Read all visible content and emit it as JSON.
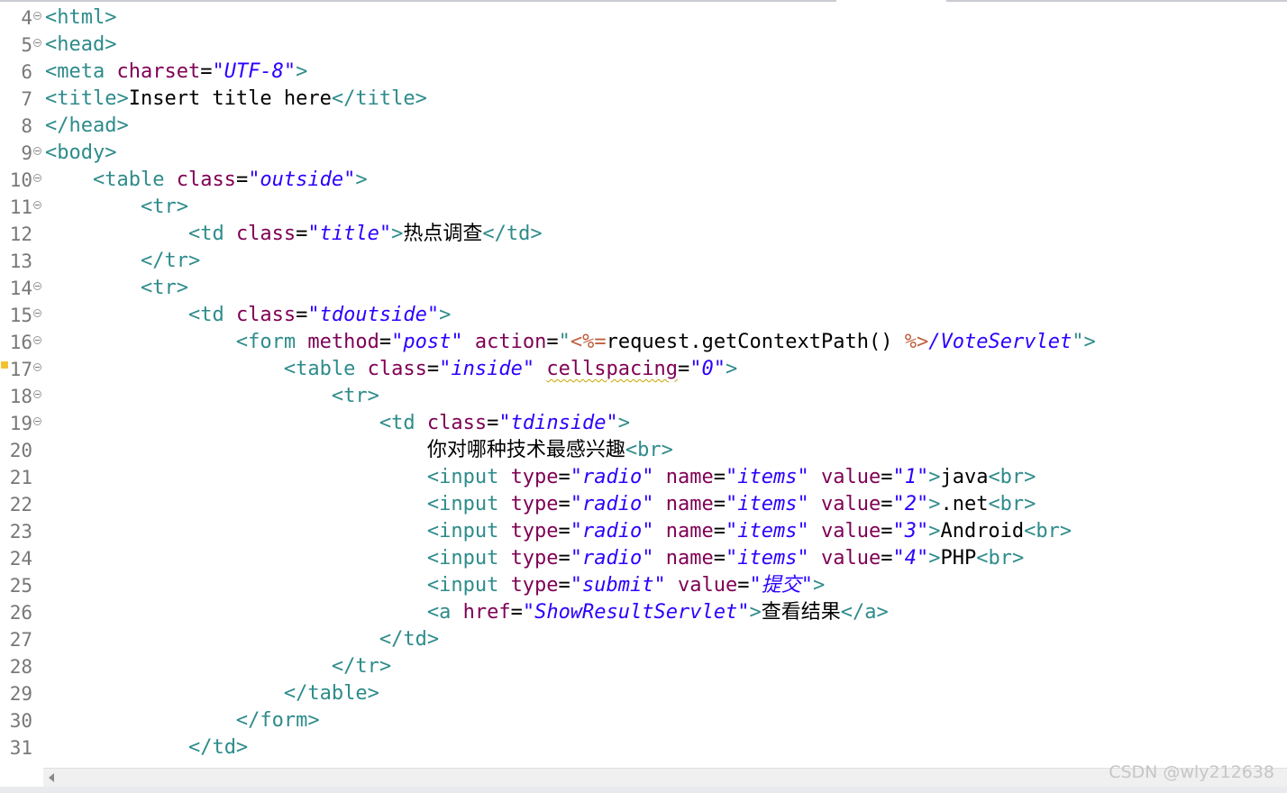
{
  "editor": {
    "lines": [
      {
        "num": "4",
        "fold": true,
        "warning": false,
        "indent": "",
        "segs": [
          [
            "t",
            "<html>"
          ]
        ]
      },
      {
        "num": "5",
        "fold": true,
        "warning": false,
        "indent": "",
        "segs": [
          [
            "t",
            "<head>"
          ]
        ]
      },
      {
        "num": "6",
        "fold": false,
        "warning": false,
        "indent": "",
        "segs": [
          [
            "t",
            "<meta "
          ],
          [
            "a",
            "charset"
          ],
          [
            "x",
            "="
          ],
          [
            "v",
            "\"UTF-8\""
          ],
          [
            "t",
            ">"
          ]
        ]
      },
      {
        "num": "7",
        "fold": false,
        "warning": false,
        "indent": "",
        "segs": [
          [
            "t",
            "<title>"
          ],
          [
            "x",
            "Insert title here"
          ],
          [
            "t",
            "</title>"
          ]
        ]
      },
      {
        "num": "8",
        "fold": false,
        "warning": false,
        "indent": "",
        "segs": [
          [
            "t",
            "</head>"
          ]
        ]
      },
      {
        "num": "9",
        "fold": true,
        "warning": false,
        "indent": "",
        "segs": [
          [
            "t",
            "<body>"
          ]
        ]
      },
      {
        "num": "10",
        "fold": true,
        "warning": false,
        "indent": "    ",
        "segs": [
          [
            "t",
            "<table "
          ],
          [
            "a",
            "class"
          ],
          [
            "x",
            "="
          ],
          [
            "v",
            "\"outside\""
          ],
          [
            "t",
            ">"
          ]
        ]
      },
      {
        "num": "11",
        "fold": true,
        "warning": false,
        "indent": "        ",
        "segs": [
          [
            "t",
            "<tr>"
          ]
        ]
      },
      {
        "num": "12",
        "fold": false,
        "warning": false,
        "indent": "            ",
        "segs": [
          [
            "t",
            "<td "
          ],
          [
            "a",
            "class"
          ],
          [
            "x",
            "="
          ],
          [
            "v",
            "\"title\""
          ],
          [
            "t",
            ">"
          ],
          [
            "xc",
            "热点调查"
          ],
          [
            "t",
            "</td>"
          ]
        ]
      },
      {
        "num": "13",
        "fold": false,
        "warning": false,
        "indent": "        ",
        "segs": [
          [
            "t",
            "</tr>"
          ]
        ]
      },
      {
        "num": "14",
        "fold": true,
        "warning": false,
        "indent": "        ",
        "segs": [
          [
            "t",
            "<tr>"
          ]
        ]
      },
      {
        "num": "15",
        "fold": true,
        "warning": false,
        "indent": "            ",
        "segs": [
          [
            "t",
            "<td "
          ],
          [
            "a",
            "class"
          ],
          [
            "x",
            "="
          ],
          [
            "v",
            "\"tdoutside\""
          ],
          [
            "t",
            ">"
          ]
        ]
      },
      {
        "num": "16",
        "fold": true,
        "warning": false,
        "indent": "                ",
        "segs": [
          [
            "t",
            "<form "
          ],
          [
            "a",
            "method"
          ],
          [
            "x",
            "="
          ],
          [
            "v",
            "\"post\""
          ],
          [
            "x",
            " "
          ],
          [
            "a",
            "action"
          ],
          [
            "x",
            "="
          ],
          [
            "t",
            "\""
          ],
          [
            "j",
            "<%="
          ],
          [
            "x",
            "request.getContextPath() "
          ],
          [
            "j",
            "%>"
          ],
          [
            "v",
            "/VoteServlet"
          ],
          [
            "t",
            "\">"
          ]
        ]
      },
      {
        "num": "17",
        "fold": true,
        "warning": true,
        "indent": "                    ",
        "segs": [
          [
            "t",
            "<table "
          ],
          [
            "a",
            "class"
          ],
          [
            "x",
            "="
          ],
          [
            "v",
            "\"inside\""
          ],
          [
            "x",
            " "
          ],
          [
            "aw",
            "cellspacing"
          ],
          [
            "x",
            "="
          ],
          [
            "v",
            "\"0\""
          ],
          [
            "t",
            ">"
          ]
        ]
      },
      {
        "num": "18",
        "fold": true,
        "warning": false,
        "indent": "                        ",
        "segs": [
          [
            "t",
            "<tr>"
          ]
        ]
      },
      {
        "num": "19",
        "fold": true,
        "warning": false,
        "indent": "                            ",
        "segs": [
          [
            "t",
            "<td "
          ],
          [
            "a",
            "class"
          ],
          [
            "x",
            "="
          ],
          [
            "v",
            "\"tdinside\""
          ],
          [
            "t",
            ">"
          ]
        ]
      },
      {
        "num": "20",
        "fold": false,
        "warning": false,
        "indent": "                                ",
        "segs": [
          [
            "xc",
            "你对哪种技术最感兴趣"
          ],
          [
            "t",
            "<br>"
          ]
        ]
      },
      {
        "num": "21",
        "fold": false,
        "warning": false,
        "indent": "                                ",
        "segs": [
          [
            "t",
            "<input "
          ],
          [
            "a",
            "type"
          ],
          [
            "x",
            "="
          ],
          [
            "v",
            "\"radio\""
          ],
          [
            "x",
            " "
          ],
          [
            "a",
            "name"
          ],
          [
            "x",
            "="
          ],
          [
            "v",
            "\"items\""
          ],
          [
            "x",
            " "
          ],
          [
            "a",
            "value"
          ],
          [
            "x",
            "="
          ],
          [
            "v",
            "\"1\""
          ],
          [
            "t",
            ">"
          ],
          [
            "x",
            "java"
          ],
          [
            "t",
            "<br>"
          ]
        ]
      },
      {
        "num": "22",
        "fold": false,
        "warning": false,
        "indent": "                                ",
        "segs": [
          [
            "t",
            "<input "
          ],
          [
            "a",
            "type"
          ],
          [
            "x",
            "="
          ],
          [
            "v",
            "\"radio\""
          ],
          [
            "x",
            " "
          ],
          [
            "a",
            "name"
          ],
          [
            "x",
            "="
          ],
          [
            "v",
            "\"items\""
          ],
          [
            "x",
            " "
          ],
          [
            "a",
            "value"
          ],
          [
            "x",
            "="
          ],
          [
            "v",
            "\"2\""
          ],
          [
            "t",
            ">"
          ],
          [
            "x",
            ".net"
          ],
          [
            "t",
            "<br>"
          ]
        ]
      },
      {
        "num": "23",
        "fold": false,
        "warning": false,
        "indent": "                                ",
        "segs": [
          [
            "t",
            "<input "
          ],
          [
            "a",
            "type"
          ],
          [
            "x",
            "="
          ],
          [
            "v",
            "\"radio\""
          ],
          [
            "x",
            " "
          ],
          [
            "a",
            "name"
          ],
          [
            "x",
            "="
          ],
          [
            "v",
            "\"items\""
          ],
          [
            "x",
            " "
          ],
          [
            "a",
            "value"
          ],
          [
            "x",
            "="
          ],
          [
            "v",
            "\"3\""
          ],
          [
            "t",
            ">"
          ],
          [
            "x",
            "Android"
          ],
          [
            "t",
            "<br>"
          ]
        ]
      },
      {
        "num": "24",
        "fold": false,
        "warning": false,
        "indent": "                                ",
        "segs": [
          [
            "t",
            "<input "
          ],
          [
            "a",
            "type"
          ],
          [
            "x",
            "="
          ],
          [
            "v",
            "\"radio\""
          ],
          [
            "x",
            " "
          ],
          [
            "a",
            "name"
          ],
          [
            "x",
            "="
          ],
          [
            "v",
            "\"items\""
          ],
          [
            "x",
            " "
          ],
          [
            "a",
            "value"
          ],
          [
            "x",
            "="
          ],
          [
            "v",
            "\"4\""
          ],
          [
            "t",
            ">"
          ],
          [
            "x",
            "PHP"
          ],
          [
            "t",
            "<br>"
          ]
        ]
      },
      {
        "num": "25",
        "fold": false,
        "warning": false,
        "indent": "                                ",
        "segs": [
          [
            "t",
            "<input "
          ],
          [
            "a",
            "type"
          ],
          [
            "x",
            "="
          ],
          [
            "v",
            "\"submit\""
          ],
          [
            "x",
            " "
          ],
          [
            "a",
            "value"
          ],
          [
            "x",
            "="
          ],
          [
            "v",
            "\""
          ],
          [
            "vc",
            "提交"
          ],
          [
            "v",
            "\""
          ],
          [
            "t",
            ">"
          ]
        ]
      },
      {
        "num": "26",
        "fold": false,
        "warning": false,
        "indent": "                                ",
        "segs": [
          [
            "t",
            "<a "
          ],
          [
            "a",
            "href"
          ],
          [
            "x",
            "="
          ],
          [
            "v",
            "\"ShowResultServlet\""
          ],
          [
            "t",
            ">"
          ],
          [
            "xc",
            "查看结果"
          ],
          [
            "t",
            "</a>"
          ]
        ]
      },
      {
        "num": "27",
        "fold": false,
        "warning": false,
        "indent": "                            ",
        "segs": [
          [
            "t",
            "</td>"
          ]
        ]
      },
      {
        "num": "28",
        "fold": false,
        "warning": false,
        "indent": "                        ",
        "segs": [
          [
            "t",
            "</tr>"
          ]
        ]
      },
      {
        "num": "29",
        "fold": false,
        "warning": false,
        "indent": "                    ",
        "segs": [
          [
            "t",
            "</table>"
          ]
        ]
      },
      {
        "num": "30",
        "fold": false,
        "warning": false,
        "indent": "                ",
        "segs": [
          [
            "t",
            "</form>"
          ]
        ]
      },
      {
        "num": "31",
        "fold": false,
        "warning": false,
        "indent": "            ",
        "segs": [
          [
            "t",
            "</td>"
          ]
        ]
      }
    ]
  },
  "watermark": "CSDN @wly212638",
  "colors": {
    "tag": "#2e8b8b",
    "attribute": "#7f0055",
    "value": "#2a00ff",
    "jsp": "#bf5f3f",
    "line_number": "#787878"
  },
  "icons": [
    "fold-toggle-icon",
    "warning-icon",
    "scroll-left-arrow-icon"
  ]
}
